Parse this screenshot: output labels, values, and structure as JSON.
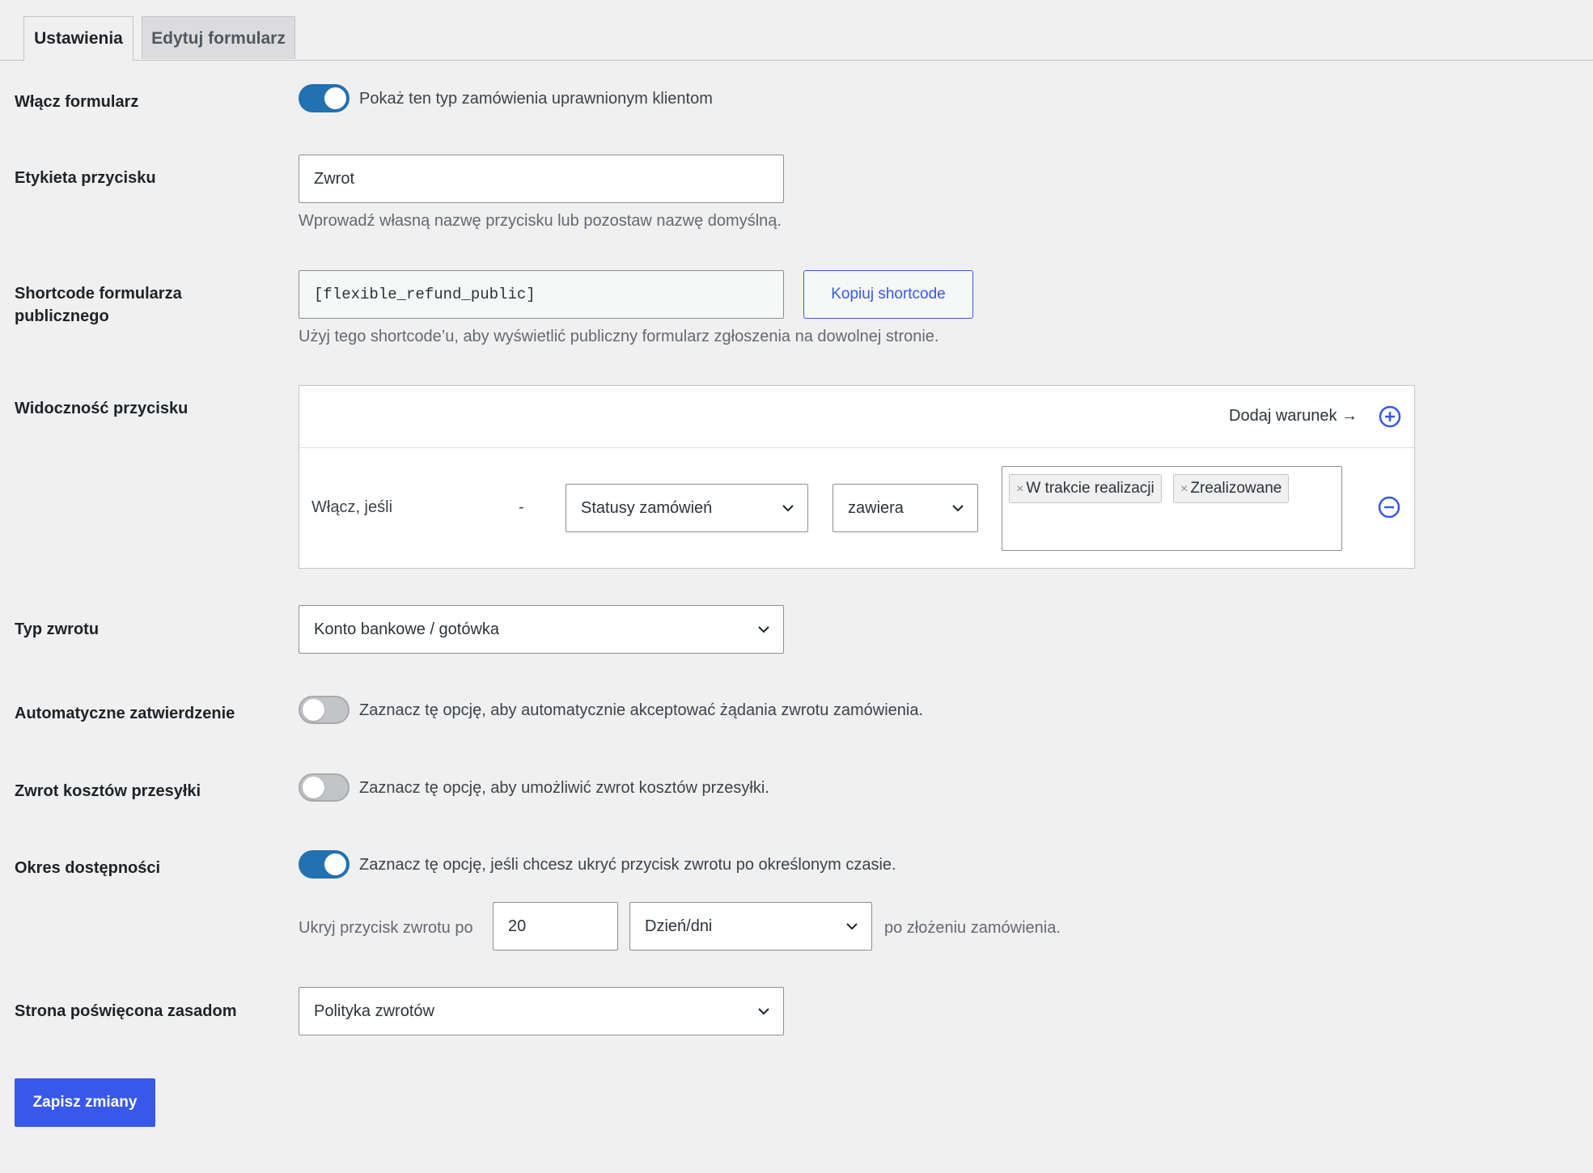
{
  "tabs": [
    {
      "label": "Ustawienia",
      "active": true
    },
    {
      "label": "Edytuj formularz",
      "active": false
    }
  ],
  "enable_form": {
    "label": "Włącz formularz",
    "toggle_on": true,
    "description": "Pokaż ten typ zamówienia uprawnionym klientom"
  },
  "button_label": {
    "label": "Etykieta przycisku",
    "value": "Zwrot",
    "help": "Wprowadź własną nazwę przycisku lub pozostaw nazwę domyślną."
  },
  "shortcode": {
    "label_line1": "Shortcode formularza",
    "label_line2": "publicznego",
    "value": "[flexible_refund_public]",
    "copy_button": "Kopiuj shortcode",
    "help": "Użyj tego shortcode’u, aby wyświetlić publiczny formularz zgłoszenia na dowolnej stronie."
  },
  "visibility": {
    "label": "Widoczność przycisku",
    "add_condition": "Dodaj warunek →",
    "condition": {
      "prefix": "Włącz, jeśli",
      "dash": "-",
      "field": "Statusy zamówień",
      "operator": "zawiera",
      "values": [
        "W trakcie realizacji",
        "Zrealizowane"
      ]
    }
  },
  "refund_type": {
    "label": "Typ zwrotu",
    "value": "Konto bankowe / gotówka"
  },
  "auto_approve": {
    "label": "Automatyczne zatwierdzenie",
    "toggle_on": false,
    "description": "Zaznacz tę opcję, aby automatycznie akceptować żądania zwrotu zamówienia."
  },
  "shipping_refund": {
    "label": "Zwrot kosztów przesyłki",
    "toggle_on": false,
    "description": "Zaznacz tę opcję, aby umożliwić zwrot kosztów przesyłki."
  },
  "availability": {
    "label": "Okres dostępności",
    "toggle_on": true,
    "description": "Zaznacz tę opcję, jeśli chcesz ukryć przycisk zwrotu po określonym czasie.",
    "hide_prefix": "Ukryj przycisk zwrotu po",
    "amount": "20",
    "unit": "Dzień/dni",
    "hide_suffix": "po złożeniu zamówienia."
  },
  "policy_page": {
    "label": "Strona poświęcona zasadom",
    "value": "Polityka zwrotów"
  },
  "save_button": "Zapisz zmiany",
  "colors": {
    "accent": "#3858e9",
    "toggle_on": "#2271b1",
    "background": "#f0f0f1"
  }
}
